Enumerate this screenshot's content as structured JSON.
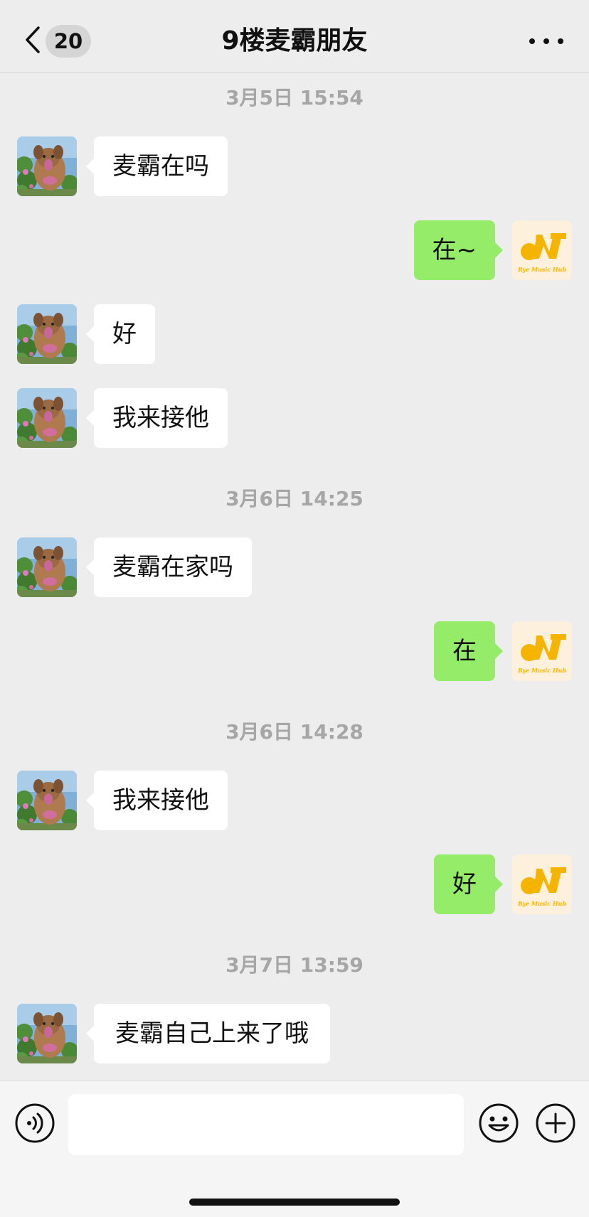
{
  "header": {
    "unread_count": "20",
    "title": "9楼麦霸朋友"
  },
  "brand_logo_text": "Rye Music Hub",
  "messages": [
    {
      "type": "timestamp",
      "text": "3月5日 15:54"
    },
    {
      "type": "incoming",
      "text": "麦霸在吗"
    },
    {
      "type": "outgoing",
      "text": "在~"
    },
    {
      "type": "incoming",
      "text": "好"
    },
    {
      "type": "incoming",
      "text": "我来接他"
    },
    {
      "type": "timestamp",
      "text": "3月6日 14:25"
    },
    {
      "type": "incoming",
      "text": "麦霸在家吗"
    },
    {
      "type": "outgoing",
      "text": "在"
    },
    {
      "type": "timestamp",
      "text": "3月6日 14:28"
    },
    {
      "type": "incoming",
      "text": "我来接他"
    },
    {
      "type": "outgoing",
      "text": "好"
    },
    {
      "type": "timestamp",
      "text": "3月7日 13:59"
    },
    {
      "type": "incoming",
      "text": "麦霸自己上来了哦"
    }
  ],
  "input": {
    "value": "",
    "placeholder": ""
  },
  "icons": {
    "back": "chevron-left-icon",
    "more": "more-dots-icon",
    "voice": "voice-icon",
    "emoji": "emoji-icon",
    "plus": "plus-icon"
  },
  "colors": {
    "background": "#ededed",
    "outgoing_bubble": "#95ec69",
    "incoming_bubble": "#ffffff",
    "timestamp_text": "#a6a6a6",
    "logo_orange": "#f5b400"
  }
}
